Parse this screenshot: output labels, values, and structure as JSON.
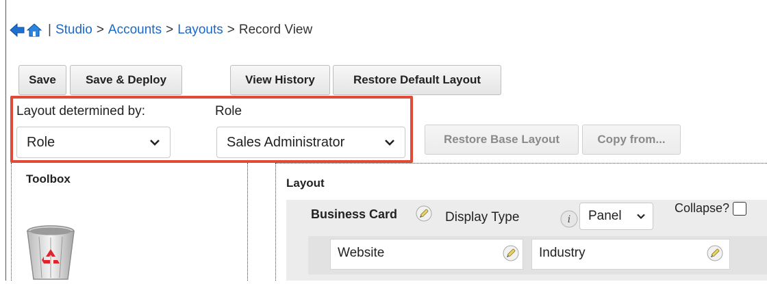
{
  "breadcrumb": {
    "icons": [
      "back-arrow-icon",
      "home-icon"
    ],
    "separator": "|",
    "links": [
      "Studio",
      "Accounts",
      "Layouts"
    ],
    "current": "Record View",
    "arrow": ">"
  },
  "toolbar": {
    "save_label": "Save",
    "save_deploy_label": "Save & Deploy",
    "view_history_label": "View History",
    "restore_default_label": "Restore Default Layout"
  },
  "role_section": {
    "determined_by_label": "Layout determined by:",
    "determined_by_value": "Role",
    "role_label": "Role",
    "role_value": "Sales Administrator",
    "highlight_color": "#e04a36"
  },
  "secondary_toolbar": {
    "restore_base_label": "Restore Base Layout",
    "copy_from_label": "Copy from..."
  },
  "toolbox": {
    "title": "Toolbox",
    "trash_icon": "recycle-bin-icon"
  },
  "layout": {
    "title": "Layout",
    "panel": {
      "name": "Business Card",
      "display_type_label": "Display Type",
      "display_type_value": "Panel",
      "collapse_label": "Collapse?",
      "collapsed": false
    },
    "fields": [
      "Website",
      "Industry"
    ]
  },
  "colors": {
    "link": "#1a68c9",
    "panel_bg": "#ececec"
  }
}
